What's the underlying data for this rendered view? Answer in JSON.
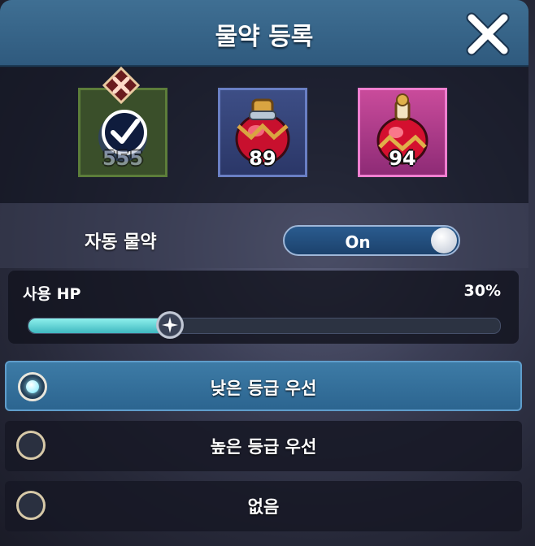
{
  "dialog": {
    "title": "물약 등록",
    "close_icon": "close-x-icon"
  },
  "potion_slots": [
    {
      "icon": "mana-potion-selected-icon",
      "count": "555",
      "selected": true,
      "frame_color": "#5c7d3a"
    },
    {
      "icon": "red-potion-icon",
      "count": "89",
      "selected": false,
      "frame_color": "#6a7fc4"
    },
    {
      "icon": "red-elixir-icon",
      "count": "94",
      "selected": false,
      "frame_color": "#f07fd0"
    }
  ],
  "auto_potion": {
    "label": "자동 물약",
    "toggle_label": "On",
    "enabled": true
  },
  "hp_threshold": {
    "label": "사용 HP",
    "value_text": "30%",
    "fraction": 0.3
  },
  "priority_options": [
    {
      "label": "낮은 등급 우선",
      "selected": true
    },
    {
      "label": "높은 등급 우선",
      "selected": false
    },
    {
      "label": "없음",
      "selected": false
    }
  ],
  "colors": {
    "header": "#3f6f93",
    "selected_option": "#3d7ba6",
    "slider_fill": "#3fb8c0"
  }
}
